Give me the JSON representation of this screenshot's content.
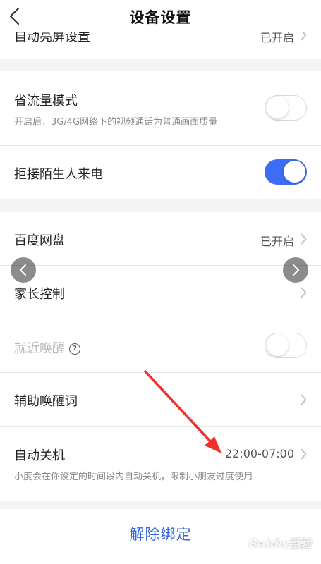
{
  "navbar": {
    "title": "设备设置",
    "back_icon": "chevron-left-icon"
  },
  "group1": {
    "partial_row": {
      "label": "自动亮屏设置",
      "value": "已开启"
    }
  },
  "group2": {
    "data_saver": {
      "label": "省流量模式",
      "subtitle": "开启后，3G/4G网络下的视频通话为普通画面质量",
      "toggle_on": false
    },
    "reject_strangers": {
      "label": "拒接陌生人来电",
      "toggle_on": true
    }
  },
  "group3": {
    "baidu_pan": {
      "label": "百度网盘",
      "value": "已开启"
    },
    "parental_control": {
      "label": "家长控制"
    },
    "nearby_wake": {
      "label": "就近唤醒",
      "help_icon_text": "?",
      "toggle_on": false,
      "disabled": true
    },
    "aux_wake_word": {
      "label": "辅助唤醒词"
    },
    "auto_shutdown": {
      "label": "自动关机",
      "value": "22:00-07:00",
      "subtitle": "小度会在你设定的时间段内自动关机，限制小朋友过度使用"
    }
  },
  "bottom": {
    "unbind_label": "解除绑定"
  },
  "overlay": {
    "watermark": "Baidu经验",
    "carousel_prev_icon": "chevron-left-icon",
    "carousel_next_icon": "chevron-right-icon",
    "annotation_arrow_color": "#f0302a"
  },
  "colors": {
    "accent": "#3d6cf6",
    "link_blue": "#2f63e8",
    "background": "#f4f4f6"
  }
}
